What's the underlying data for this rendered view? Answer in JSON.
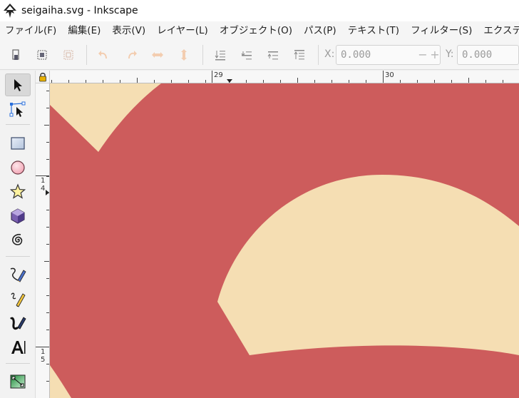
{
  "window": {
    "title": "seigaiha.svg - Inkscape"
  },
  "menu": [
    "ファイル(F)",
    "編集(E)",
    "表示(V)",
    "レイヤー(L)",
    "オブジェクト(O)",
    "パス(P)",
    "テキスト(T)",
    "フィルター(S)",
    "エクステンション(N)"
  ],
  "toolbar": {
    "x_label": "X:",
    "x_value": "0.000",
    "y_label": "Y:",
    "y_value": "0.000",
    "minus": "−",
    "plus": "+"
  },
  "rulers": {
    "h_label_29": "29",
    "h_label_30": "30",
    "v_label_14": "1\n4",
    "v_label_15": "1\n5"
  },
  "colors": {
    "background_red": "#cd5c5c",
    "wave_cream": "#f5deb3",
    "accent_blue": "#2a6fdb"
  }
}
